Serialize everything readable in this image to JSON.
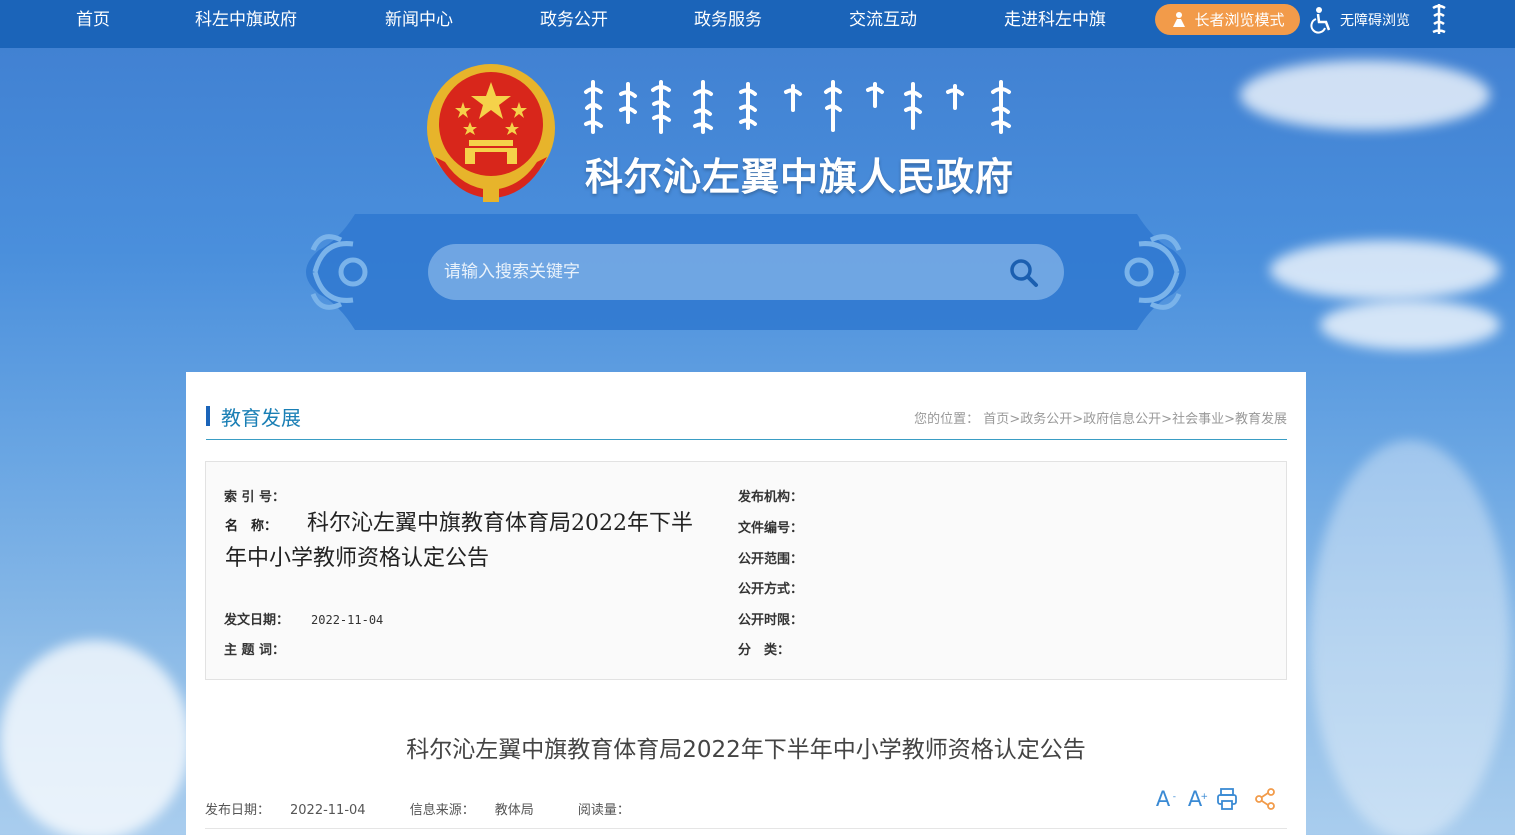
{
  "nav": {
    "items": [
      "首页",
      "科左中旗政府",
      "新闻中心",
      "政务公开",
      "政务服务",
      "交流互动",
      "走进科左中旗"
    ],
    "elder_mode": "长者浏览模式",
    "accessible": "无障碍浏览"
  },
  "header": {
    "site_title": "科尔沁左翼中旗人民政府"
  },
  "search": {
    "placeholder": "请输入搜索关键字"
  },
  "section": {
    "title": "教育发展",
    "breadcrumb_prefix": "您的位置：",
    "breadcrumb": [
      "首页",
      "政务公开",
      "政府信息公开",
      "社会事业",
      "教育发展"
    ],
    "separator": ">"
  },
  "info": {
    "index_label": "索 引 号：",
    "name_label": "名　称：",
    "name_value": "科尔沁左翼中旗教育体育局2022年下半年中小学教师资格认定公告",
    "date_label": "发文日期：",
    "date_value": "2022-11-04",
    "topic_label": "主 题 词：",
    "org_label": "发布机构：",
    "doc_no_label": "文件编号：",
    "scope_label": "公开范围：",
    "method_label": "公开方式：",
    "time_limit_label": "公开时限：",
    "category_label": "分　类："
  },
  "article": {
    "title": "科尔沁左翼中旗教育体育局2022年下半年中小学教师资格认定公告",
    "publish_label": "发布日期：",
    "publish_value": "2022-11-04",
    "source_label": "信息来源：",
    "source_value": "教体局",
    "reads_label": "阅读量："
  },
  "tools": {
    "font_small": "A",
    "font_small_sign": "-",
    "font_large": "A",
    "font_large_sign": "+"
  },
  "colors": {
    "nav_bg": "#1b64b9",
    "elder_btn": "#f29b4a",
    "accent": "#1a7fb5"
  }
}
